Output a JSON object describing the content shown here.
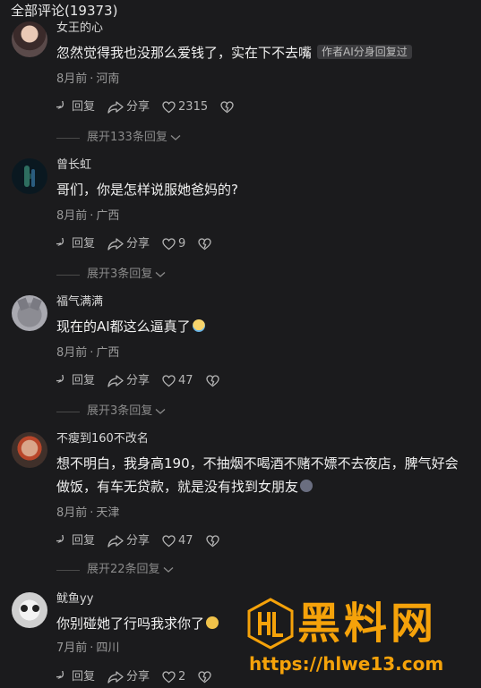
{
  "header": {
    "title": "全部评论(19373)"
  },
  "actions": {
    "reply_label": "回复",
    "share_label": "分享"
  },
  "comments": [
    {
      "name": "女王的心",
      "text": "忽然觉得我也没那么爱钱了，实在下不去嘴",
      "tag": "作者AI分身回复过",
      "time": "8月前",
      "location": "河南",
      "likes": "2315",
      "expand": "展开133条回复"
    },
    {
      "name": "曾长虹",
      "text": "哥们，你是怎样说服她爸妈的?",
      "time": "8月前",
      "location": "广西",
      "likes": "9",
      "expand": "展开3条回复"
    },
    {
      "name": "福气满满",
      "text": "现在的AI都这么逼真了",
      "time": "8月前",
      "location": "广西",
      "likes": "47",
      "expand": "展开3条回复"
    },
    {
      "name": "不瘦到160不改名",
      "text": "想不明白，我身高190，不抽烟不喝酒不赌不嫖不去夜店，脾气好会做饭，有车无贷款，就是没有找到女朋友",
      "time": "8月前",
      "location": "天津",
      "likes": "47",
      "expand": "展开22条回复"
    },
    {
      "name": "鱿鱼yy",
      "text": "你别碰她了行吗我求你了",
      "time": "7月前",
      "location": "四川",
      "likes": "2"
    }
  ],
  "watermark": {
    "title": "黑料网",
    "url": "https://hlwe13.com"
  },
  "colors": {
    "background": "#1b1b1d",
    "watermark": "#f5a20a"
  }
}
